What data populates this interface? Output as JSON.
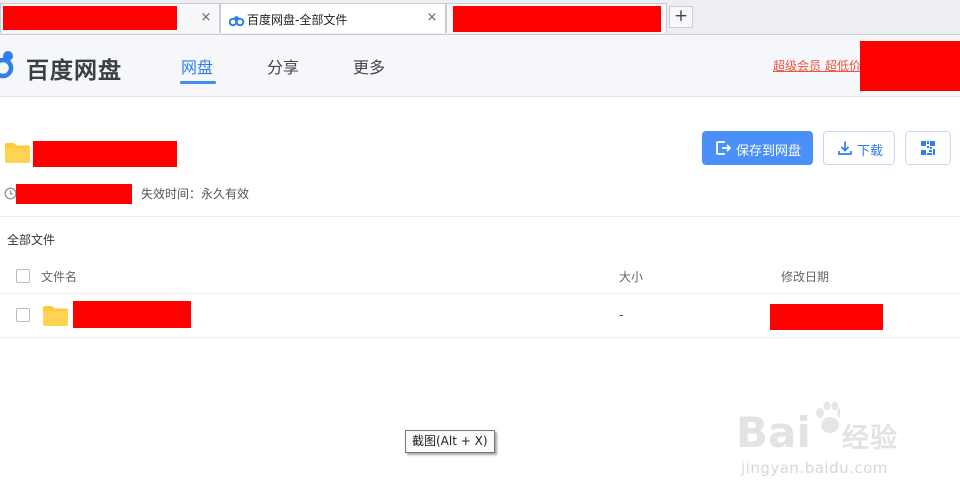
{
  "browser": {
    "tabs": [
      {
        "title": "",
        "redacted": true
      },
      {
        "title": "百度网盘-全部文件",
        "redacted": false
      },
      {
        "title": "",
        "redacted": true
      }
    ],
    "close_glyph": "×",
    "new_tab_glyph": "+"
  },
  "header": {
    "brand": "百度网盘",
    "nav": [
      {
        "label": "网盘",
        "active": true
      },
      {
        "label": "分享",
        "active": false
      },
      {
        "label": "更多",
        "active": false
      }
    ],
    "vip_link": "超级会员 超低价"
  },
  "share": {
    "expire_label": "失效时间：永久有效",
    "buttons": {
      "save": "保存到网盘",
      "download": "下载"
    }
  },
  "breadcrumb": "全部文件",
  "table": {
    "columns": {
      "name": "文件名",
      "size": "大小",
      "modified": "修改日期"
    },
    "rows": [
      {
        "name": "",
        "size": "-",
        "modified": ""
      }
    ]
  },
  "tooltip": "截图(Alt + X)",
  "watermark": {
    "text": "经验",
    "url": "jingyan.baidu.com"
  },
  "colors": {
    "accent": "#2f7ff0",
    "vip": "#f0533f",
    "folder": "#ffc93c",
    "redaction": "#ff0000"
  },
  "icons": {
    "tab_favicon": "baidu-netdisk-logo-icon",
    "save": "save-to-disk-icon",
    "download": "download-icon",
    "qr": "qr-code-icon",
    "expire": "clock-icon",
    "folder": "folder-icon"
  }
}
